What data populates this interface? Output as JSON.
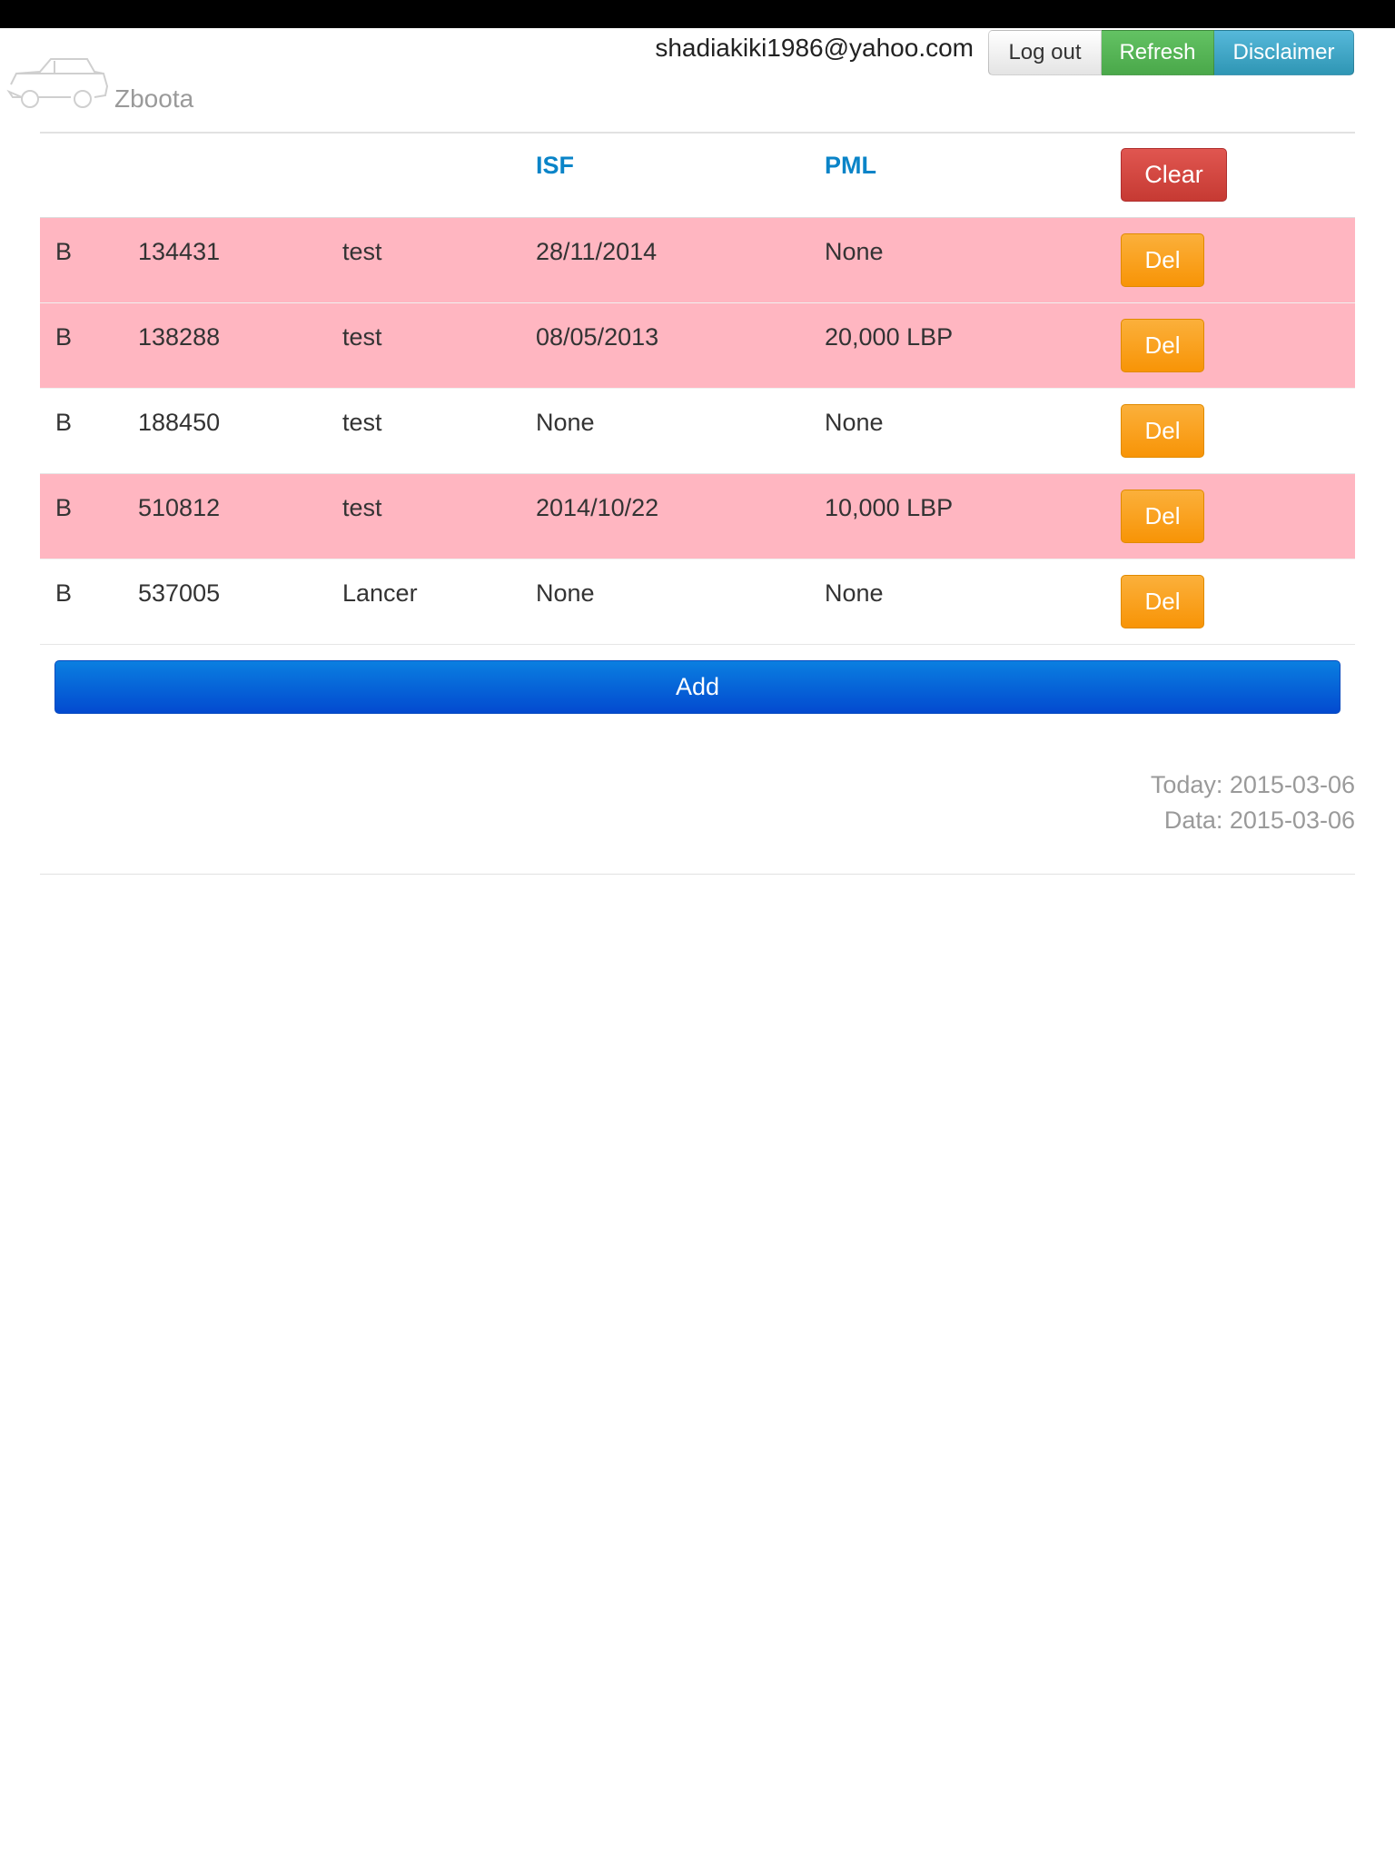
{
  "header": {
    "brand": "Zboota",
    "user_email": "shadiakiki1986@yahoo.com",
    "buttons": {
      "logout": "Log out",
      "refresh": "Refresh",
      "disclaimer": "Disclaimer"
    }
  },
  "table": {
    "columns": [
      "",
      "",
      "",
      "ISF",
      "PML"
    ],
    "clear_label": "Clear",
    "del_label": "Del",
    "rows": [
      {
        "area": "B",
        "number": "134431",
        "label": "test",
        "isf": "28/11/2014",
        "pml": "None",
        "highlight": true
      },
      {
        "area": "B",
        "number": "138288",
        "label": "test",
        "isf": "08/05/2013",
        "pml": "20,000 LBP",
        "highlight": true
      },
      {
        "area": "B",
        "number": "188450",
        "label": "test",
        "isf": "None",
        "pml": "None",
        "highlight": false
      },
      {
        "area": "B",
        "number": "510812",
        "label": "test",
        "isf": "2014/10/22",
        "pml": "10,000 LBP",
        "highlight": true
      },
      {
        "area": "B",
        "number": "537005",
        "label": "Lancer",
        "isf": "None",
        "pml": "None",
        "highlight": false
      }
    ]
  },
  "add_label": "Add",
  "footer": {
    "today": "Today: 2015-03-06",
    "data": "Data: 2015-03-06"
  },
  "colors": {
    "highlight_row": "#ffb6c1",
    "header_text": "#0a84c8",
    "del_button": "#f89406",
    "clear_button": "#c63a33",
    "add_button": "#034ad0"
  }
}
